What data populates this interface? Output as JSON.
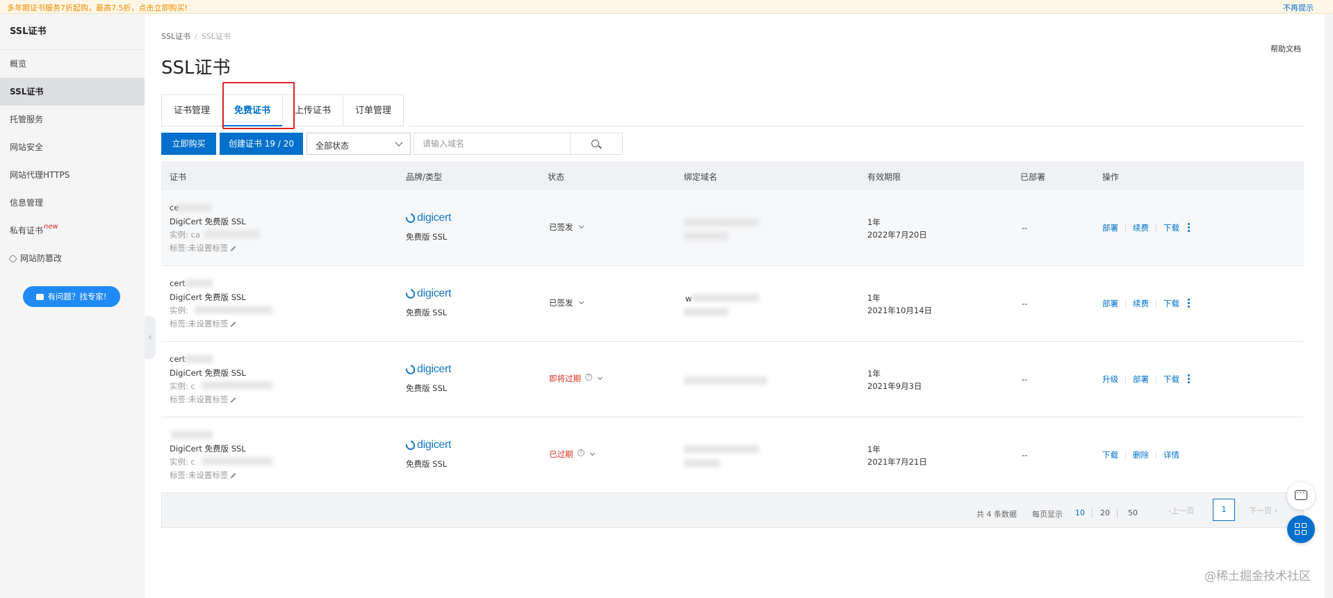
{
  "banner": {
    "text": "多年期证书服务7折起购，最高7.5折，点击立即购买!",
    "dismiss": "不再提示"
  },
  "sidebar": {
    "title": "SSL证书",
    "items": [
      {
        "label": "概览"
      },
      {
        "label": "SSL证书",
        "active": true
      },
      {
        "label": "托管服务"
      },
      {
        "label": "网站安全"
      },
      {
        "label": "网站代理HTTPS"
      },
      {
        "label": "信息管理"
      },
      {
        "label": "私有证书",
        "badge": "new"
      },
      {
        "label": "网站防篡改",
        "icon": "link-icon"
      }
    ],
    "expert_button": "有问题？找专家!"
  },
  "breadcrumb": {
    "root": "SSL证书",
    "sep": "/",
    "current": "SSL证书"
  },
  "page_title": "SSL证书",
  "help_link": "帮助文档",
  "tabs": [
    {
      "label": "证书管理"
    },
    {
      "label": "免费证书",
      "active": true
    },
    {
      "label": "上传证书"
    },
    {
      "label": "订单管理"
    }
  ],
  "toolbar": {
    "buy_button": "立即购买",
    "create_button": "创建证书 19 / 20",
    "status_select": "全部状态",
    "search_placeholder": "请输入域名"
  },
  "table": {
    "headers": [
      "证书",
      "品牌/类型",
      "状态",
      "绑定域名",
      "有效期限",
      "已部署",
      "操作"
    ],
    "rows": [
      {
        "name_prefix": "ce",
        "product": "DigiCert 免费版 SSL",
        "instance_prefix": "实例: ca",
        "tags": "标签:未设置标签",
        "brand": "digicert",
        "type": "免费版 SSL",
        "status": "已签发",
        "status_kind": "ok",
        "domain_prefix": "",
        "term": "1年",
        "expiry": "2022年7月20日",
        "deployed": "--",
        "actions": [
          "部署",
          "续费",
          "下载"
        ],
        "more": true
      },
      {
        "name_prefix": "cert",
        "product": "DigiCert 免费版 SSL",
        "instance_prefix": "实例:",
        "tags": "标签:未设置标签",
        "brand": "digicert",
        "type": "免费版 SSL",
        "status": "已签发",
        "status_kind": "ok",
        "domain_prefix": "w",
        "term": "1年",
        "expiry": "2021年10月14日",
        "deployed": "--",
        "actions": [
          "部署",
          "续费",
          "下载"
        ],
        "more": true
      },
      {
        "name_prefix": "cert",
        "product": "DigiCert 免费版 SSL",
        "instance_prefix": "实例: c",
        "tags": "标签:未设置标签",
        "brand": "digicert",
        "type": "免费版 SSL",
        "status": "即将过期",
        "status_kind": "warn",
        "domain_prefix": "",
        "term": "1年",
        "expiry": "2021年9月3日",
        "deployed": "--",
        "actions": [
          "升级",
          "部署",
          "下载"
        ],
        "more": true
      },
      {
        "name_prefix": "",
        "product": "DigiCert 免费版 SSL",
        "instance_prefix": "实例: c",
        "tags": "标签:未设置标签",
        "brand": "digicert",
        "type": "免费版 SSL",
        "status": "已过期",
        "status_kind": "exp",
        "domain_prefix": "",
        "term": "1年",
        "expiry": "2021年7月21日",
        "deployed": "--",
        "actions": [
          "下载",
          "删除",
          "详情"
        ],
        "more": false
      }
    ]
  },
  "pagination": {
    "total": "共 4 条数据",
    "per_page_label": "每页显示",
    "sizes": [
      "10",
      "20",
      "50"
    ],
    "active_size": "10",
    "prev": "上一页",
    "page": "1",
    "next": "下一页"
  },
  "watermark": "@稀土掘金技术社区",
  "colors": {
    "primary": "#0070cc",
    "danger": "#d93026",
    "tab_highlight": "#e02020",
    "banner_text": "#f08c00"
  }
}
